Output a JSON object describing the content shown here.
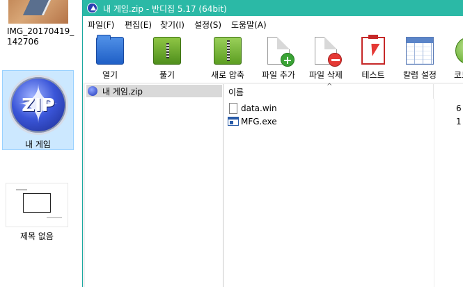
{
  "desktop": {
    "img_file_label_line1": "IMG_20170419_",
    "img_file_label_line2": "142706",
    "zip_icon_text": "ZIP",
    "zip_label": "내 게임",
    "untitled_label": "제목 없음"
  },
  "window": {
    "title": "내 게임.zip - 반디집 5.17 (64bit)",
    "accent_color": "#2bb9a6"
  },
  "menu": [
    {
      "label": "파일(F)"
    },
    {
      "label": "편집(E)"
    },
    {
      "label": "찾기(I)"
    },
    {
      "label": "설정(S)"
    },
    {
      "label": "도움말(A)"
    }
  ],
  "toolbar": [
    {
      "label": "열기",
      "icon": "folder-open-icon"
    },
    {
      "label": "풀기",
      "icon": "extract-icon"
    },
    {
      "label": "새로 압축",
      "icon": "new-archive-icon"
    },
    {
      "label": "파일 추가",
      "icon": "add-file-icon"
    },
    {
      "label": "파일 삭제",
      "icon": "delete-file-icon"
    },
    {
      "label": "테스트",
      "icon": "test-icon"
    },
    {
      "label": "칼럼 설정",
      "icon": "columns-icon"
    },
    {
      "label": "코드",
      "icon": "code-icon"
    }
  ],
  "tree": {
    "root_label": "내 게임.zip"
  },
  "list": {
    "name_header": "이름",
    "rows": [
      {
        "name": "data.win",
        "size": "6",
        "icon": "file-icon"
      },
      {
        "name": "MFG.exe",
        "size": "1",
        "icon": "exe-file-icon"
      }
    ]
  }
}
